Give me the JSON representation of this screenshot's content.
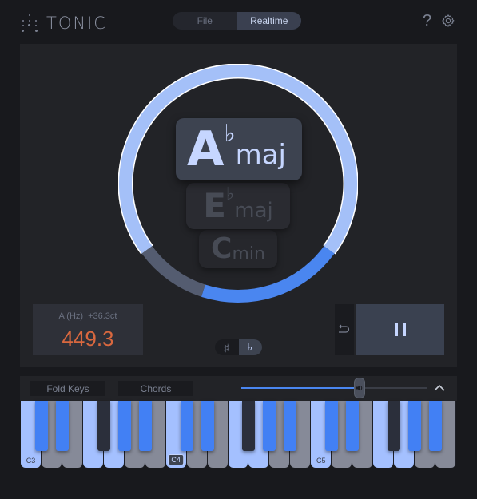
{
  "header": {
    "app_name": "TONIC",
    "mode_tabs": [
      {
        "label": "File",
        "active": false
      },
      {
        "label": "Realtime",
        "active": true
      }
    ],
    "help_icon": "?",
    "settings_icon": "gear-icon"
  },
  "detection": {
    "primary": {
      "root": "A",
      "accidental": "♭",
      "quality": "maj"
    },
    "secondary": {
      "root": "E",
      "accidental": "♭",
      "quality": "maj"
    },
    "tertiary": {
      "root": "C",
      "accidental": "",
      "quality": "min"
    },
    "confidence_ring": {
      "segments": [
        {
          "label": "primary",
          "fraction": 0.7,
          "color": "#a4c0f8"
        },
        {
          "label": "secondary",
          "fraction": 0.2,
          "color": "#4a86f0"
        },
        {
          "label": "tertiary",
          "fraction": 0.1,
          "color": "#545c70"
        }
      ]
    }
  },
  "tuning": {
    "label": "A (Hz)",
    "cents": "+36.3ct",
    "value": "449.3",
    "value_color": "#d9683f"
  },
  "accidental_toggle": [
    {
      "label": "♯",
      "active": false
    },
    {
      "label": "♭",
      "active": true
    }
  ],
  "transport": {
    "back_icon": "return-icon",
    "pause_icon": "pause-icon"
  },
  "keyboard_bar": {
    "fold_keys_label": "Fold Keys",
    "chords_label": "Chords",
    "volume": 0.64,
    "volume_icon": "speaker-icon",
    "collapse_icon": "chevron-up-icon"
  },
  "keyboard": {
    "octave_labels": [
      "C3",
      "C4",
      "C5"
    ],
    "current_octave": "C4",
    "white_keys": [
      {
        "note": "C3",
        "on": true
      },
      {
        "note": "D3",
        "on": false
      },
      {
        "note": "E3",
        "on": false
      },
      {
        "note": "F3",
        "on": true
      },
      {
        "note": "G3",
        "on": true
      },
      {
        "note": "A3",
        "on": false
      },
      {
        "note": "B3",
        "on": false
      },
      {
        "note": "C4",
        "on": true
      },
      {
        "note": "D4",
        "on": false
      },
      {
        "note": "E4",
        "on": false
      },
      {
        "note": "F4",
        "on": true
      },
      {
        "note": "G4",
        "on": true
      },
      {
        "note": "A4",
        "on": false
      },
      {
        "note": "B4",
        "on": false
      },
      {
        "note": "C5",
        "on": true
      },
      {
        "note": "D5",
        "on": false
      },
      {
        "note": "E5",
        "on": false
      },
      {
        "note": "F5",
        "on": true
      },
      {
        "note": "G5",
        "on": true
      },
      {
        "note": "A5",
        "on": false
      },
      {
        "note": "B5",
        "on": false
      }
    ],
    "black_keys": [
      {
        "note": "Db3",
        "after": 0,
        "on": true
      },
      {
        "note": "Eb3",
        "after": 1,
        "on": true
      },
      {
        "note": "Gb3",
        "after": 3,
        "on": false
      },
      {
        "note": "Ab3",
        "after": 4,
        "on": true
      },
      {
        "note": "Bb3",
        "after": 5,
        "on": true
      },
      {
        "note": "Db4",
        "after": 7,
        "on": true
      },
      {
        "note": "Eb4",
        "after": 8,
        "on": true
      },
      {
        "note": "Gb4",
        "after": 10,
        "on": false
      },
      {
        "note": "Ab4",
        "after": 11,
        "on": true
      },
      {
        "note": "Bb4",
        "after": 12,
        "on": true
      },
      {
        "note": "Db5",
        "after": 14,
        "on": true
      },
      {
        "note": "Eb5",
        "after": 15,
        "on": true
      },
      {
        "note": "Gb5",
        "after": 17,
        "on": false
      },
      {
        "note": "Ab5",
        "after": 18,
        "on": true
      },
      {
        "note": "Bb5",
        "after": 19,
        "on": true
      }
    ]
  }
}
